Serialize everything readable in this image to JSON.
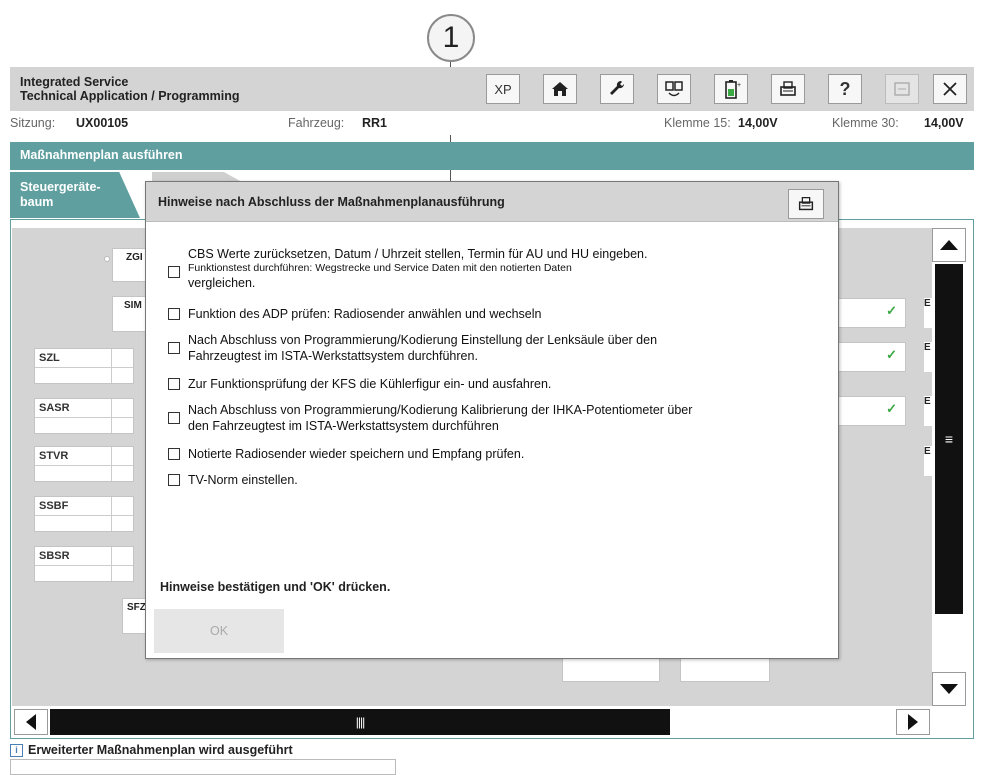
{
  "callout": {
    "number": "1"
  },
  "app": {
    "title_line1": "Integrated Service",
    "title_line2": "Technical Application / Programming"
  },
  "toolbar": {
    "xp_label": "XP",
    "icons": [
      "home-icon",
      "wrench-icon",
      "compare-icon",
      "battery-icon",
      "print-icon",
      "help-icon",
      "disabled-icon",
      "close-icon"
    ],
    "help_label": "?"
  },
  "session": {
    "sitzung_label": "Sitzung:",
    "sitzung_value": "UX00105",
    "fahrzeug_label": "Fahrzeug:",
    "fahrzeug_value": "RR1",
    "klemme15_label": "Klemme 15:",
    "klemme15_value": "14,00V",
    "klemme30_label": "Klemme 30:",
    "klemme30_value": "14,00V"
  },
  "section_title": "Maßnahmenplan ausführen",
  "tabs": {
    "steuer_line1": "Steuergeräte-",
    "steuer_line2": "baum"
  },
  "tree": {
    "nodes_left": [
      "SZL",
      "SASR",
      "STVR",
      "SSBF",
      "SBSR"
    ],
    "partial_labels": [
      "ZGI",
      "SIM",
      "SFZ"
    ],
    "right_edge_label": "E"
  },
  "dialog": {
    "title": "Hinweise nach Abschluss der Maßnahmenplanausführung",
    "items": [
      {
        "line1": "CBS Werte zurücksetzen, Datum / Uhrzeit stellen, Termin für AU und HU eingeben.",
        "line2": "Funktionstest durchführen: Wegstrecke und Service Daten mit den notierten Daten",
        "line3": "vergleichen."
      },
      {
        "line1": "Funktion des ADP prüfen: Radiosender anwählen und wechseln"
      },
      {
        "line1": "Nach Abschluss von Programmierung/Kodierung Einstellung der Lenksäule über den",
        "line2": "Fahrzeugtest im ISTA-Werkstattsystem durchführen."
      },
      {
        "line1": "Zur Funktionsprüfung der KFS die Kühlerfigur ein- und ausfahren."
      },
      {
        "line1": "Nach Abschluss von Programmierung/Kodierung Kalibrierung der IHKA-Potentiometer über",
        "line2": "den Fahrzeugtest im ISTA-Werkstattsystem durchführen"
      },
      {
        "line1": "Notierte Radiosender wieder speichern und Empfang prüfen."
      },
      {
        "line1": "TV-Norm einstellen."
      }
    ],
    "footer": "Hinweise bestätigen und 'OK' drücken.",
    "ok_label": "OK"
  },
  "status": {
    "icon": "info-icon",
    "text": "Erweiterter Maßnahmenplan wird ausgeführt"
  },
  "colors": {
    "accent": "#5f9fa0",
    "check": "#3aa843",
    "canvas": "#d4d4d4"
  }
}
